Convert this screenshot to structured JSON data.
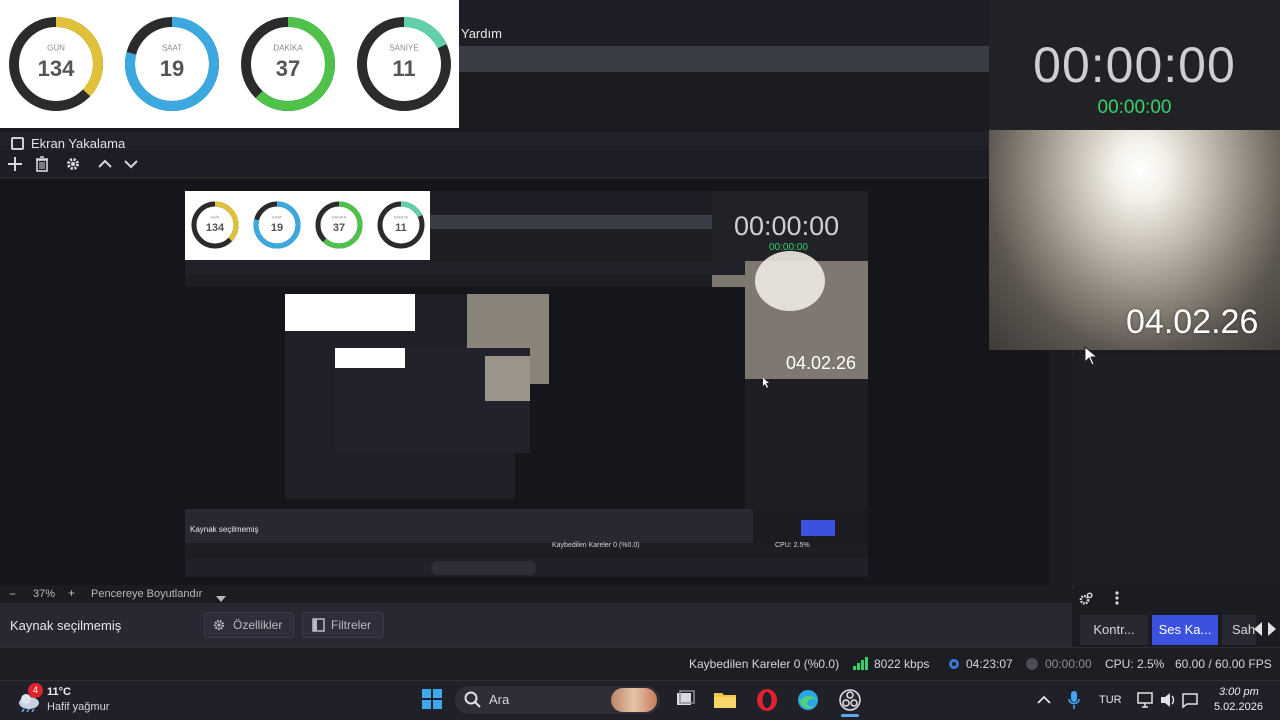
{
  "menu": {
    "help": "Yardım"
  },
  "countdown": {
    "items": [
      {
        "label": "GÜN",
        "value": "134",
        "color": "#e2c13a",
        "fraction": 0.37
      },
      {
        "label": "SAAT",
        "value": "19",
        "color": "#3ba9df",
        "fraction": 0.79
      },
      {
        "label": "DAKİKA",
        "value": "37",
        "color": "#4fc24a",
        "fraction": 0.62
      },
      {
        "label": "SANİYE",
        "value": "11",
        "color": "#5fd0a8",
        "fraction": 0.18
      }
    ],
    "track_color": "#2b2b2b"
  },
  "sources": {
    "title": "Ekran Yakalama",
    "toolbar": {
      "add_icon": "plus-icon",
      "remove_icon": "trash-icon",
      "settings_icon": "gear-icon",
      "up_icon": "chevron-up-icon",
      "down_icon": "chevron-down-icon"
    }
  },
  "zoom": {
    "minus": "−",
    "value": "37%",
    "plus": "+",
    "fit_label": "Pencereye Boyutlandır"
  },
  "properties": {
    "no_source": "Kaynak seçilmemiş",
    "properties_button": "Özellikler",
    "filters_button": "Filtreler"
  },
  "clock_panel": {
    "big_time": "00:00:00",
    "small_time": "00:00:00",
    "camera_date": "04.02.26"
  },
  "dock": {
    "tabs": [
      {
        "label": "Kontr...",
        "active": false
      },
      {
        "label": "Ses Ka...",
        "active": true
      },
      {
        "label": "Sah",
        "active": false
      }
    ]
  },
  "status": {
    "dropped_frames": "Kaybedilen Kareler 0 (%0.0)",
    "bitrate": "8022 kbps",
    "rec_time": "04:23:07",
    "stream_time": "00:00:00",
    "cpu": "CPU: 2.5%",
    "fps": "60.00 / 60.00 FPS"
  },
  "taskbar": {
    "weather_badge": "4",
    "weather_temp": "11°C",
    "weather_desc": "Hafif yağmur",
    "search_placeholder": "Ara",
    "language": "TUR",
    "time": "3:00 pm",
    "date": "5.02.2026"
  },
  "colors": {
    "accent_blue": "#3b51e0",
    "green": "#39d26a",
    "brand_red": "#e0222d"
  }
}
